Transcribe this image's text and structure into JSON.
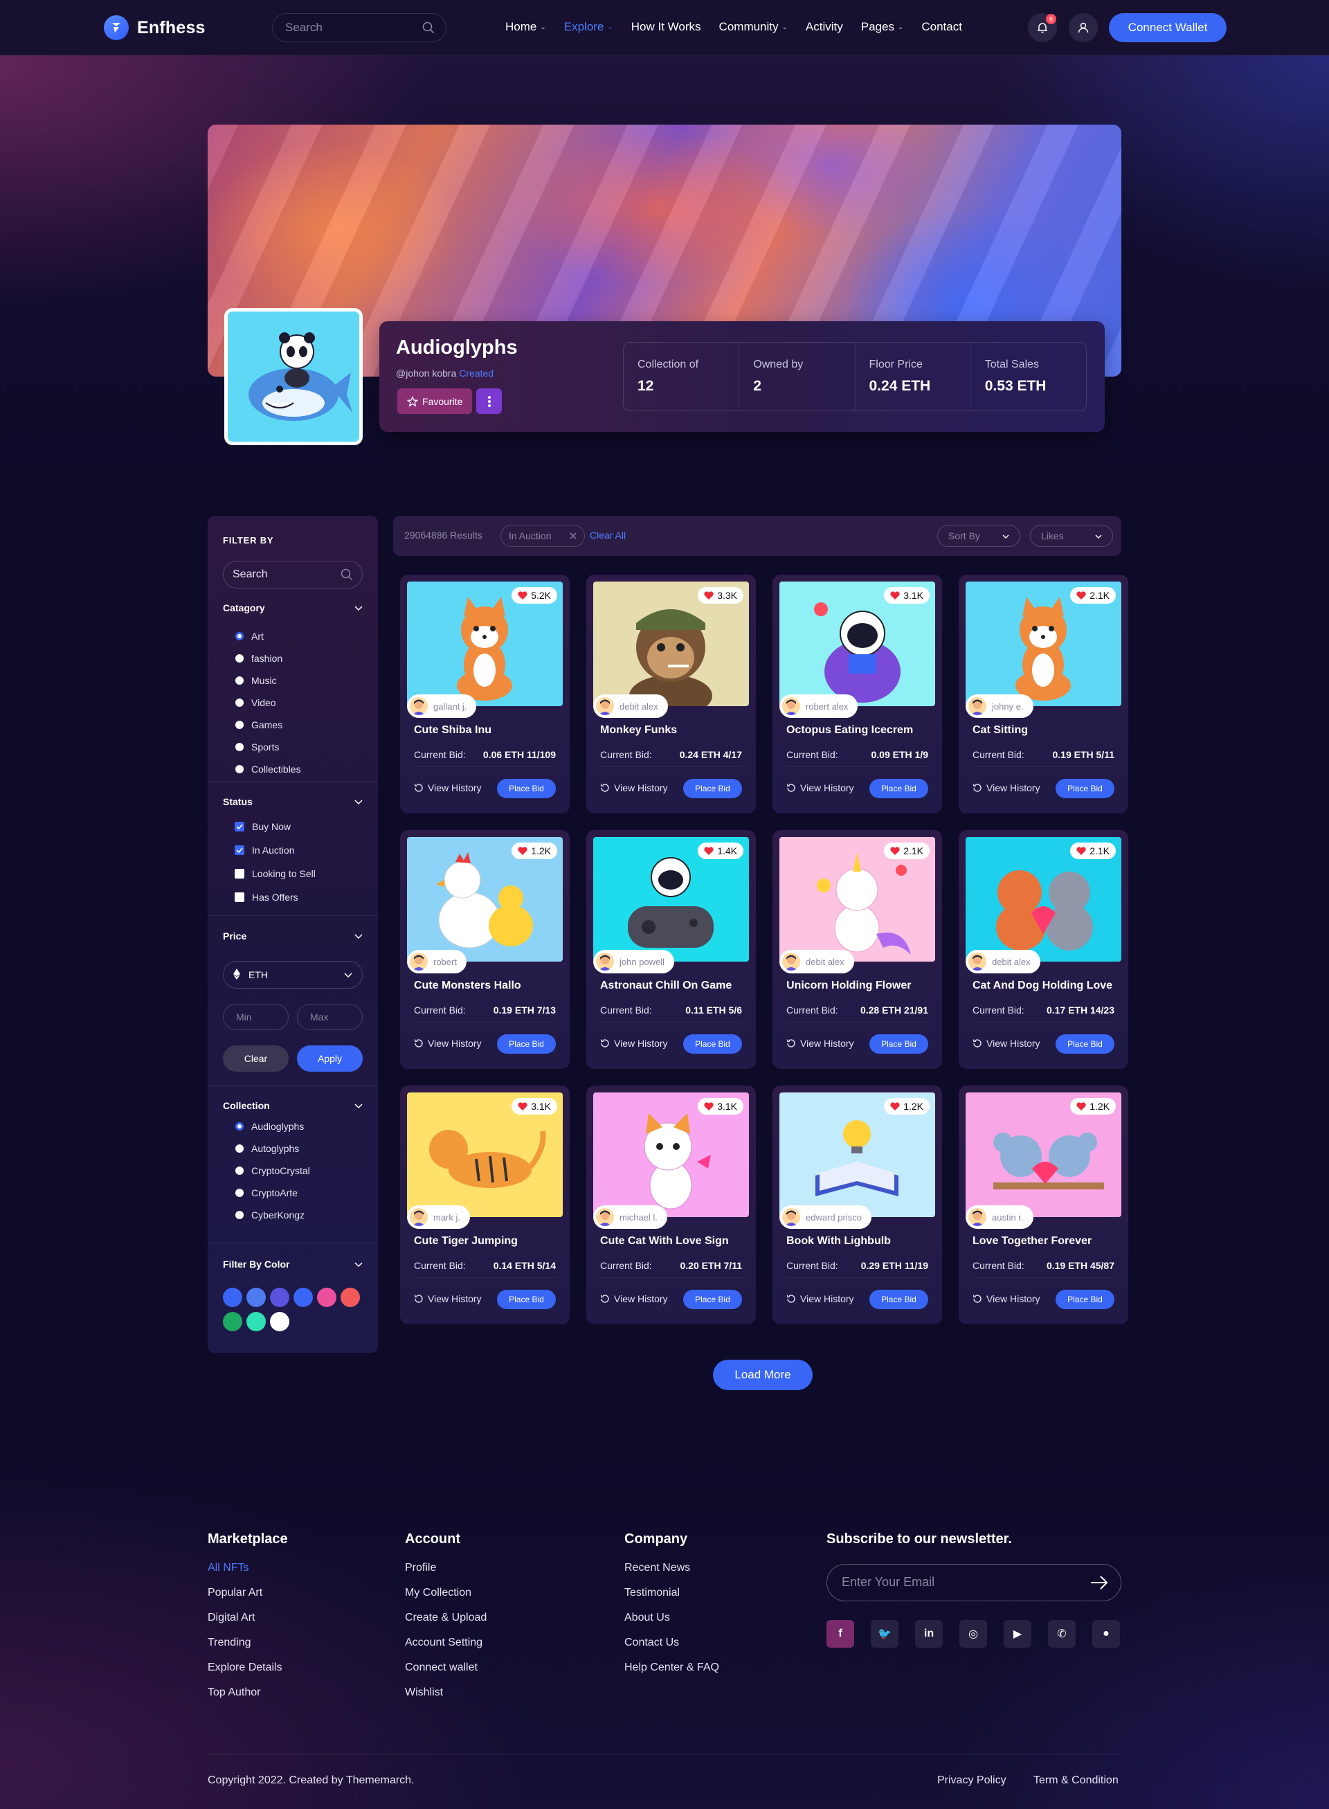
{
  "header": {
    "logo_text": "Enfhess",
    "search_placeholder": "Search",
    "nav": [
      {
        "label": "Home",
        "dropdown": true
      },
      {
        "label": "Explore",
        "dropdown": true,
        "active": true
      },
      {
        "label": "How It Works",
        "dropdown": false
      },
      {
        "label": "Community",
        "dropdown": true
      },
      {
        "label": "Activity",
        "dropdown": false
      },
      {
        "label": "Pages",
        "dropdown": true
      },
      {
        "label": "Contact",
        "dropdown": false
      }
    ],
    "notification_count": "8",
    "connect_label": "Connect Wallet"
  },
  "profile": {
    "name": "Audioglyphs",
    "handle": "@johon kobra",
    "created": "Created",
    "favourite_label": "Favourite",
    "stats": [
      {
        "label": "Collection of",
        "value": "12"
      },
      {
        "label": "Owned by",
        "value": "2"
      },
      {
        "label": "Floor Price",
        "value": "0.24 ETH"
      },
      {
        "label": "Total Sales",
        "value": "0.53 ETH"
      }
    ]
  },
  "sidebar": {
    "title": "FILTER BY",
    "search_placeholder": "Search",
    "category_title": "Catagory",
    "categories": [
      {
        "label": "Art",
        "selected": true
      },
      {
        "label": "fashion",
        "selected": false
      },
      {
        "label": "Music",
        "selected": false
      },
      {
        "label": "Video",
        "selected": false
      },
      {
        "label": "Games",
        "selected": false
      },
      {
        "label": "Sports",
        "selected": false
      },
      {
        "label": "Collectibles",
        "selected": false
      }
    ],
    "status_title": "Status",
    "statuses": [
      {
        "label": "Buy Now",
        "checked": true
      },
      {
        "label": "In Auction",
        "checked": true
      },
      {
        "label": "Looking to Sell",
        "checked": false
      },
      {
        "label": "Has Offers",
        "checked": false
      }
    ],
    "price_title": "Price",
    "currency": "ETH",
    "min_placeholder": "Min",
    "max_placeholder": "Max",
    "clear_label": "Clear",
    "apply_label": "Apply",
    "collection_title": "Collection",
    "collections": [
      {
        "label": "Audioglyphs",
        "selected": true
      },
      {
        "label": "Autoglyphs",
        "selected": false
      },
      {
        "label": "CryptoCrystal",
        "selected": false
      },
      {
        "label": "CryptoArte",
        "selected": false
      },
      {
        "label": "CyberKongz",
        "selected": false
      }
    ],
    "color_title": "Filter By Color",
    "colors": [
      "#3a66f6",
      "#4f7bf0",
      "#5b52e0",
      "#3a66f6",
      "#ec4f9c",
      "#f25a5a",
      "#1faa64",
      "#2ee0b4",
      "#ffffff"
    ]
  },
  "toolbar": {
    "results": "29064886 Results",
    "chip": "In Auction",
    "clear_all": "Clear All",
    "sort_label": "Sort By",
    "likes_label": "Likes"
  },
  "cards": [
    {
      "title": "Cute Shiba Inu",
      "likes": "5.2K",
      "owner": "gallant j.",
      "bid_label": "Current Bid:",
      "bid": "0.06 ETH 11/109",
      "history": "View History",
      "cta": "Place Bid",
      "bg": "#5fd8f6",
      "art": "shiba"
    },
    {
      "title": "Monkey Funks",
      "likes": "3.3K",
      "owner": "debit alex",
      "bid_label": "Current Bid:",
      "bid": "0.24 ETH 4/17",
      "history": "View History",
      "cta": "Place Bid",
      "bg": "#e5ddb0",
      "art": "ape"
    },
    {
      "title": "Octopus Eating Icecrem",
      "likes": "3.1K",
      "owner": "robert alex",
      "bid_label": "Current Bid:",
      "bid": "0.09 ETH 1/9",
      "history": "View History",
      "cta": "Place Bid",
      "bg": "#8ff1f5",
      "art": "astro-read"
    },
    {
      "title": "Cat Sitting",
      "likes": "2.1K",
      "owner": "johny e.",
      "bid_label": "Current Bid:",
      "bid": "0.19 ETH 5/11",
      "history": "View History",
      "cta": "Place Bid",
      "bg": "#5fd8f6",
      "art": "shiba"
    },
    {
      "title": "Cute Monsters Hallo",
      "likes": "1.2K",
      "owner": "robert",
      "bid_label": "Current Bid:",
      "bid": "0.19 ETH 7/13",
      "history": "View History",
      "cta": "Place Bid",
      "bg": "#8dd3f7",
      "art": "chicken"
    },
    {
      "title": "Astronaut Chill On Game",
      "likes": "1.4K",
      "owner": "john powell",
      "bid_label": "Current Bid:",
      "bid": "0.11 ETH 5/6",
      "history": "View History",
      "cta": "Place Bid",
      "bg": "#1fdcec",
      "art": "astro-game"
    },
    {
      "title": "Unicorn Holding Flower",
      "likes": "2.1K",
      "owner": "debit alex",
      "bid_label": "Current Bid:",
      "bid": "0.28 ETH 21/91",
      "history": "View History",
      "cta": "Place Bid",
      "bg": "#fdc4e2",
      "art": "unicorn"
    },
    {
      "title": "Cat And Dog Holding Love",
      "likes": "2.1K",
      "owner": "debit alex",
      "bid_label": "Current Bid:",
      "bid": "0.17 ETH 14/23",
      "history": "View History",
      "cta": "Place Bid",
      "bg": "#1fd0ec",
      "art": "catdog"
    },
    {
      "title": "Cute Tiger Jumping",
      "likes": "3.1K",
      "owner": "mark j.",
      "bid_label": "Current Bid:",
      "bid": "0.14 ETH 5/14",
      "history": "View History",
      "cta": "Place Bid",
      "bg": "#fde16a",
      "art": "tiger"
    },
    {
      "title": "Cute Cat With Love Sign",
      "likes": "3.1K",
      "owner": "michael l.",
      "bid_label": "Current Bid:",
      "bid": "0.20 ETH 7/11",
      "history": "View History",
      "cta": "Place Bid",
      "bg": "#f9a6f0",
      "art": "cat"
    },
    {
      "title": "Book With Lighbulb",
      "likes": "1.2K",
      "owner": "edward prisco",
      "bid_label": "Current Bid:",
      "bid": "0.29 ETH 11/19",
      "history": "View History",
      "cta": "Place Bid",
      "bg": "#c2ebfb",
      "art": "book"
    },
    {
      "title": "Love Together Forever",
      "likes": "1.2K",
      "owner": "austin r.",
      "bid_label": "Current Bid:",
      "bid": "0.19 ETH 45/87",
      "history": "View History",
      "cta": "Place Bid",
      "bg": "#f9a6e6",
      "art": "koala"
    }
  ],
  "load_more": "Load More",
  "footer": {
    "columns": [
      {
        "title": "Marketplace",
        "links": [
          "All NFTs",
          "Popular Art",
          "Digital Art",
          "Trending",
          "Explore Details",
          "Top Author"
        ]
      },
      {
        "title": "Account",
        "links": [
          "Profile",
          "My Collection",
          "Create & Upload",
          "Account Setting",
          "Connect wallet",
          "Wishlist"
        ]
      },
      {
        "title": "Company",
        "links": [
          "Recent News",
          "Testimonial",
          "About Us",
          "Contact Us",
          "Help Center & FAQ"
        ]
      }
    ],
    "newsletter_title": "Subscribe to our newsletter.",
    "email_placeholder": "Enter Your Email",
    "socials": [
      "facebook-icon",
      "twitter-icon",
      "linkedin-icon",
      "instagram-icon",
      "youtube-icon",
      "whatsapp-icon",
      "github-icon"
    ],
    "copyright": "Copyright 2022. Created by Thememarch.",
    "privacy": "Privacy Policy",
    "terms": "Term & Condition"
  }
}
